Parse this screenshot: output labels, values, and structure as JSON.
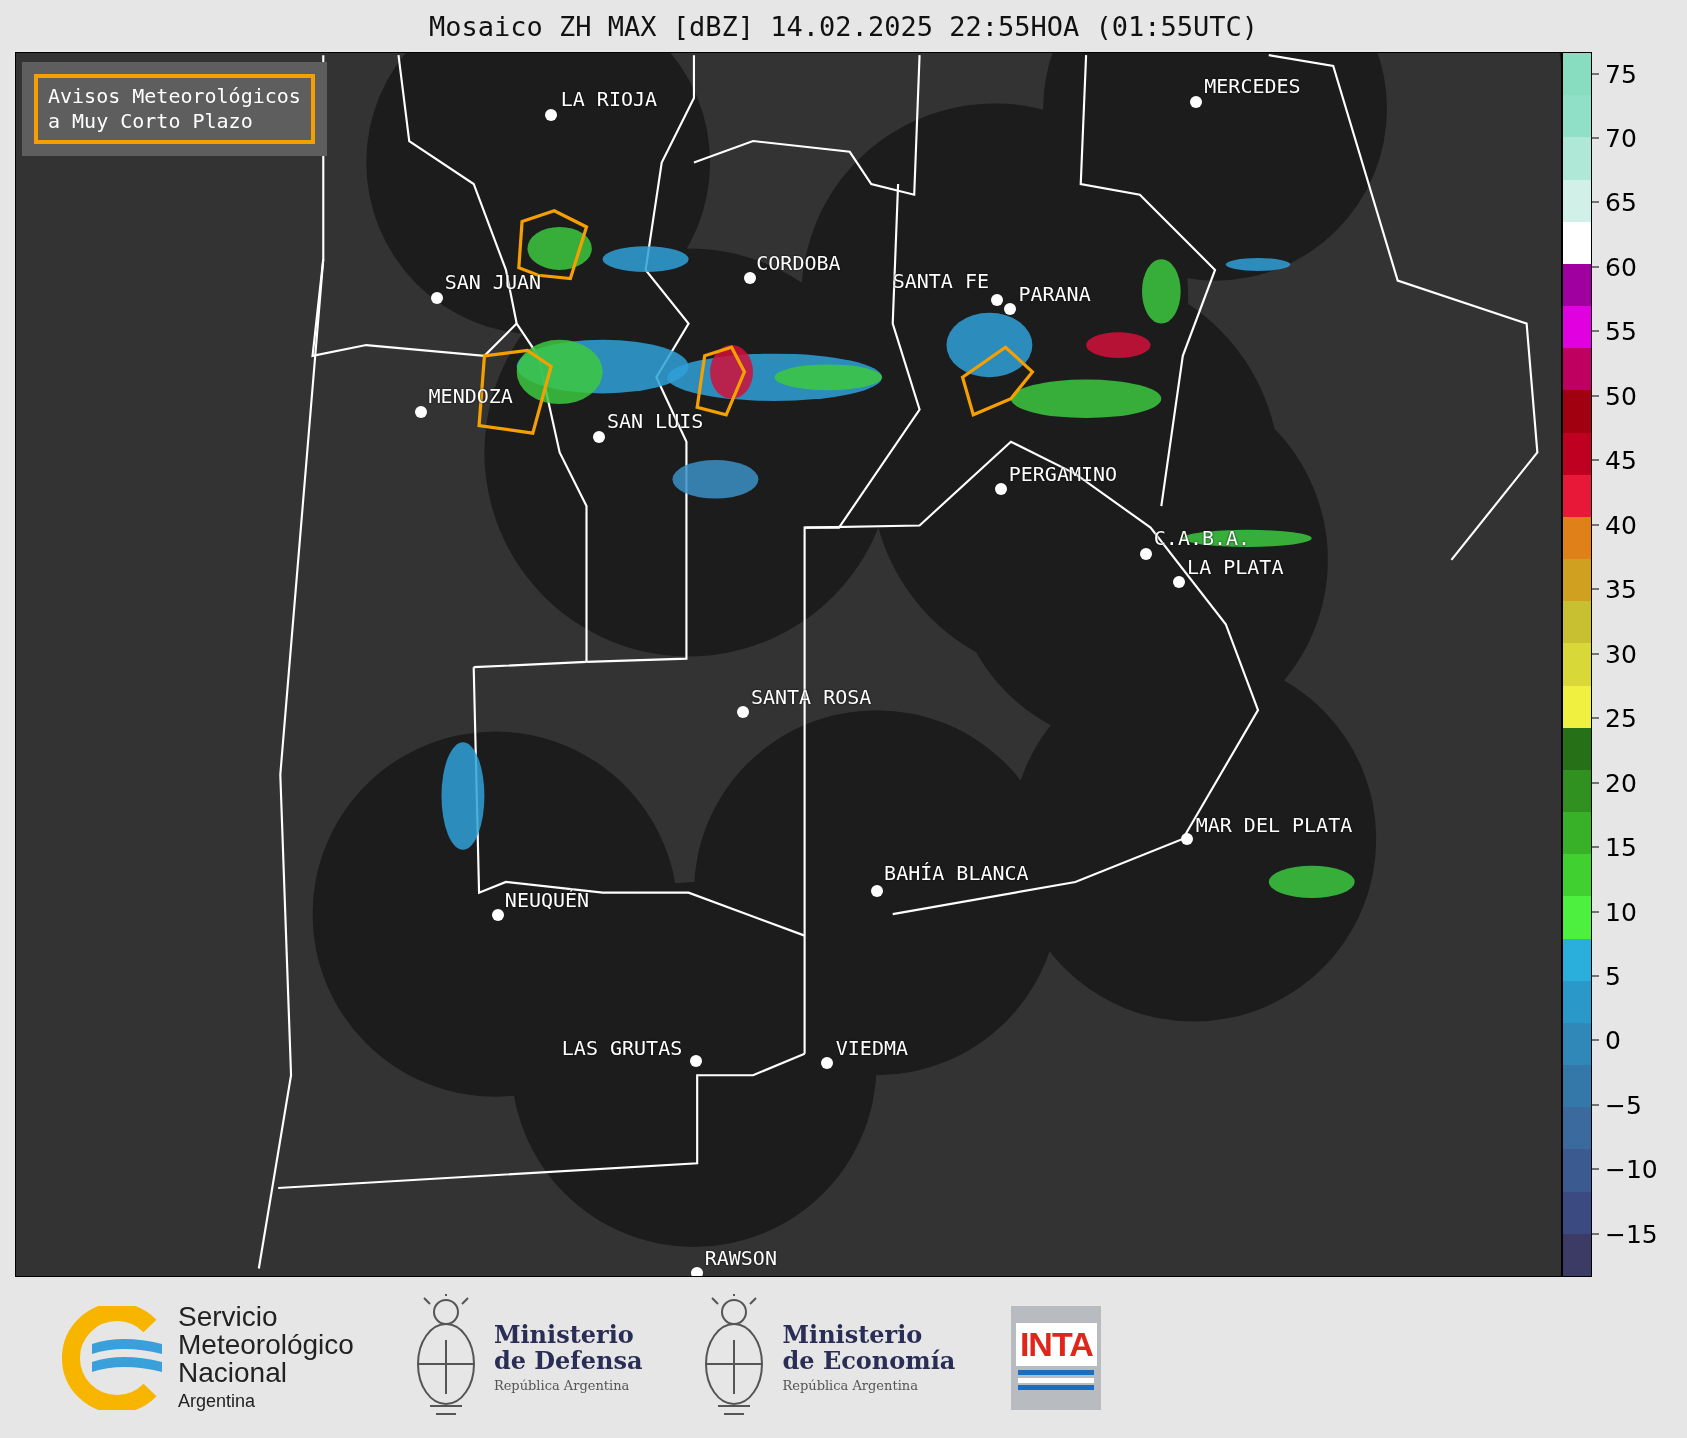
{
  "title": "Mosaico ZH MAX [dBZ] 14.02.2025 22:55HOA (01:55UTC)",
  "legend_box": {
    "lines": [
      "Avisos Meteorológicos",
      "a Muy Corto Plazo"
    ]
  },
  "cities": [
    {
      "name": "LA RIOJA"
    },
    {
      "name": "MERCEDES"
    },
    {
      "name": "CORDOBA"
    },
    {
      "name": "SAN JUAN"
    },
    {
      "name": "SANTA FE"
    },
    {
      "name": "PARANA"
    },
    {
      "name": "MENDOZA"
    },
    {
      "name": "SAN LUIS"
    },
    {
      "name": "PERGAMINO"
    },
    {
      "name": "C.A.B.A."
    },
    {
      "name": "LA PLATA"
    },
    {
      "name": "SANTA ROSA"
    },
    {
      "name": "MAR DEL PLATA"
    },
    {
      "name": "BAHÍA BLANCA"
    },
    {
      "name": "NEUQUÉN"
    },
    {
      "name": "LAS GRUTAS"
    },
    {
      "name": "VIEDMA"
    },
    {
      "name": "RAWSON"
    }
  ],
  "colorbar": {
    "ticks": [
      "75",
      "70",
      "65",
      "60",
      "55",
      "50",
      "45",
      "40",
      "35",
      "30",
      "25",
      "20",
      "15",
      "10",
      "5",
      "0",
      "−5",
      "−10",
      "−15"
    ]
  },
  "logos": [
    {
      "kind": "smn",
      "lines": [
        "Servicio",
        "Meteorológico",
        "Nacional"
      ],
      "sub": "Argentina"
    },
    {
      "kind": "ministry",
      "lines": [
        "Ministerio",
        "de Defensa"
      ],
      "sub": "República Argentina"
    },
    {
      "kind": "ministry",
      "lines": [
        "Ministerio",
        "de Economía"
      ],
      "sub": "República Argentina"
    },
    {
      "kind": "inta",
      "lines": [
        "INTA"
      ]
    }
  ]
}
